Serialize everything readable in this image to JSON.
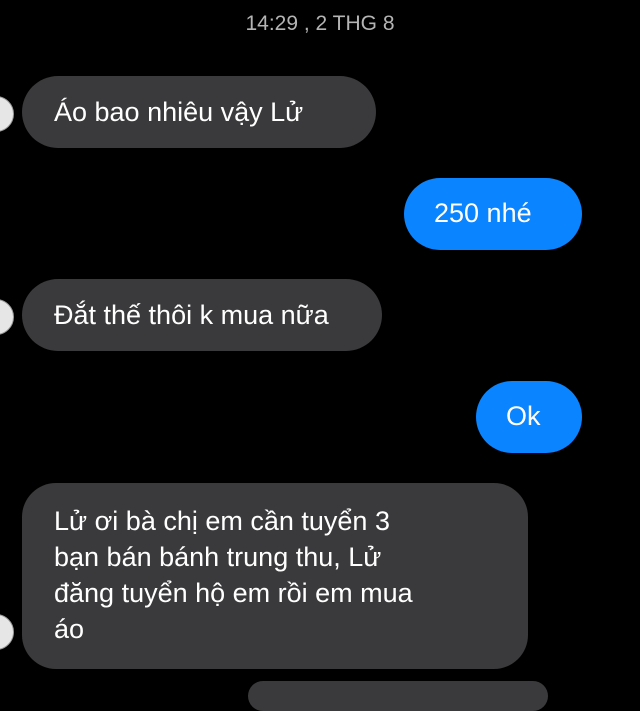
{
  "header": {
    "timestamp": "14:29 , 2 THG 8"
  },
  "messages": [
    {
      "sender": "other",
      "text": "Áo bao nhiêu vậy Lử"
    },
    {
      "sender": "me",
      "text": "250 nhé"
    },
    {
      "sender": "other",
      "text": "Đắt thế thôi k mua nữa"
    },
    {
      "sender": "me",
      "text": "Ok"
    },
    {
      "sender": "other",
      "lines": [
        "Lử ơi bà chị em cần tuyển 3",
        "bạn bán bánh trung thu, Lử",
        "đăng tuyển hộ em rồi em mua",
        "áo"
      ]
    }
  ],
  "colors": {
    "background": "#000000",
    "incoming_bubble": "#3a3a3c",
    "outgoing_bubble": "#0a84ff",
    "timestamp_text": "#b4b4b4"
  }
}
